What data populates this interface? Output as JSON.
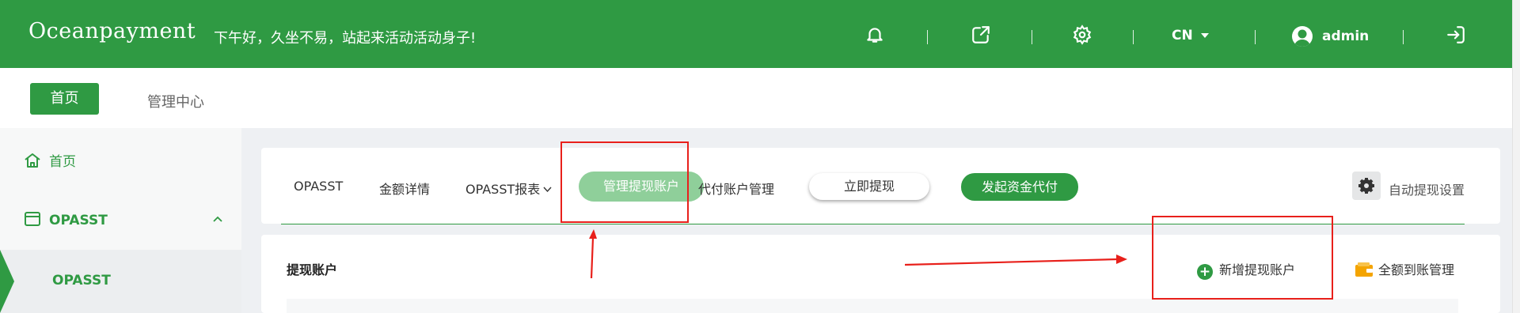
{
  "header": {
    "logo": "Oceanpayment",
    "greeting": "下午好，久坐不易，站起来活动活动身子!",
    "language": "CN",
    "username": "admin",
    "background": "#2f9a43",
    "icons": [
      "bell-icon",
      "external-link-icon",
      "gear-icon",
      "user-avatar-icon",
      "logout-icon"
    ]
  },
  "topnav": {
    "items": [
      {
        "label": "首页",
        "active": true
      },
      {
        "label": "管理中心",
        "active": false
      }
    ]
  },
  "sidebar": {
    "home": "首页",
    "group": "OPASST",
    "active_item": "OPASST",
    "icons": [
      "home-icon",
      "card-icon",
      "chevron-up-icon"
    ]
  },
  "tabs": {
    "items": [
      {
        "label": "OPASST"
      },
      {
        "label": "金额详情"
      },
      {
        "label": "OPASST报表"
      },
      {
        "label": "管理提现账户",
        "active": true
      },
      {
        "label": "代付账户管理"
      }
    ],
    "withdraw_now": "立即提现",
    "initiate_payout": "发起资金代付",
    "auto_settings": "自动提现设置"
  },
  "content": {
    "section_title": "提现账户",
    "add_account": "新增提现账户",
    "full_amount_manage": "全额到账管理"
  },
  "colors": {
    "brand": "#2f9a43",
    "active_tab": "#8fcf9a",
    "annotation": "#e8201b",
    "wallet": "#f4a400"
  }
}
